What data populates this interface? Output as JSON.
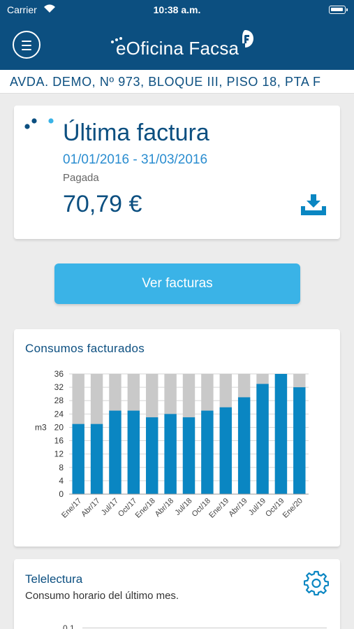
{
  "status_bar": {
    "carrier": "Carrier",
    "time": "10:38 a.m."
  },
  "header": {
    "app_name": "eOficina Facsa"
  },
  "address": "AVDA. DEMO, Nº 973, BLOQUE III, PISO 18, PTA F",
  "last_invoice": {
    "title": "Última factura",
    "period": "01/01/2016 - 31/03/2016",
    "status": "Pagada",
    "amount": "70,79 €"
  },
  "ver_facturas_label": "Ver facturas",
  "consumos": {
    "title": "Consumos facturados"
  },
  "telelectura": {
    "title": "Telelectura",
    "subtitle": "Consumo horario del último mes.",
    "partial_tick": "0,1"
  },
  "colors": {
    "primary": "#0c4f80",
    "accent": "#3ab3e7",
    "bar": "#0a86c2",
    "bar_bg": "#c9c9c9"
  },
  "chart_data": {
    "type": "bar",
    "title": "Consumos facturados",
    "ylabel": "m3",
    "ylim": [
      0,
      36
    ],
    "yticks": [
      0,
      4,
      8,
      12,
      16,
      20,
      24,
      28,
      32,
      36
    ],
    "categories": [
      "Ene/17",
      "Abr/17",
      "Jul/17",
      "Oct/17",
      "Ene/18",
      "Abr/18",
      "Jul/18",
      "Oct/18",
      "Ene/19",
      "Abr/19",
      "Jul/19",
      "Oct/19",
      "Ene/20"
    ],
    "series": [
      {
        "values": [
          21,
          21,
          25,
          25,
          23,
          24,
          23,
          25,
          26,
          29,
          33,
          36,
          32
        ]
      }
    ]
  }
}
